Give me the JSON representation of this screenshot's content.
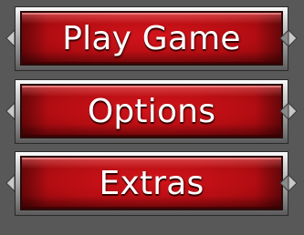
{
  "menu": {
    "items": [
      {
        "label": "Play Game"
      },
      {
        "label": "Options"
      },
      {
        "label": "Extras"
      }
    ]
  },
  "theme": {
    "background": "#585858",
    "button_red": "#b30d12",
    "frame_light": "#d9d9d9",
    "text": "#ffffff"
  },
  "icons": {
    "left_stud": "arrow-left-stud-icon",
    "right_stud": "arrow-right-stud-icon"
  }
}
